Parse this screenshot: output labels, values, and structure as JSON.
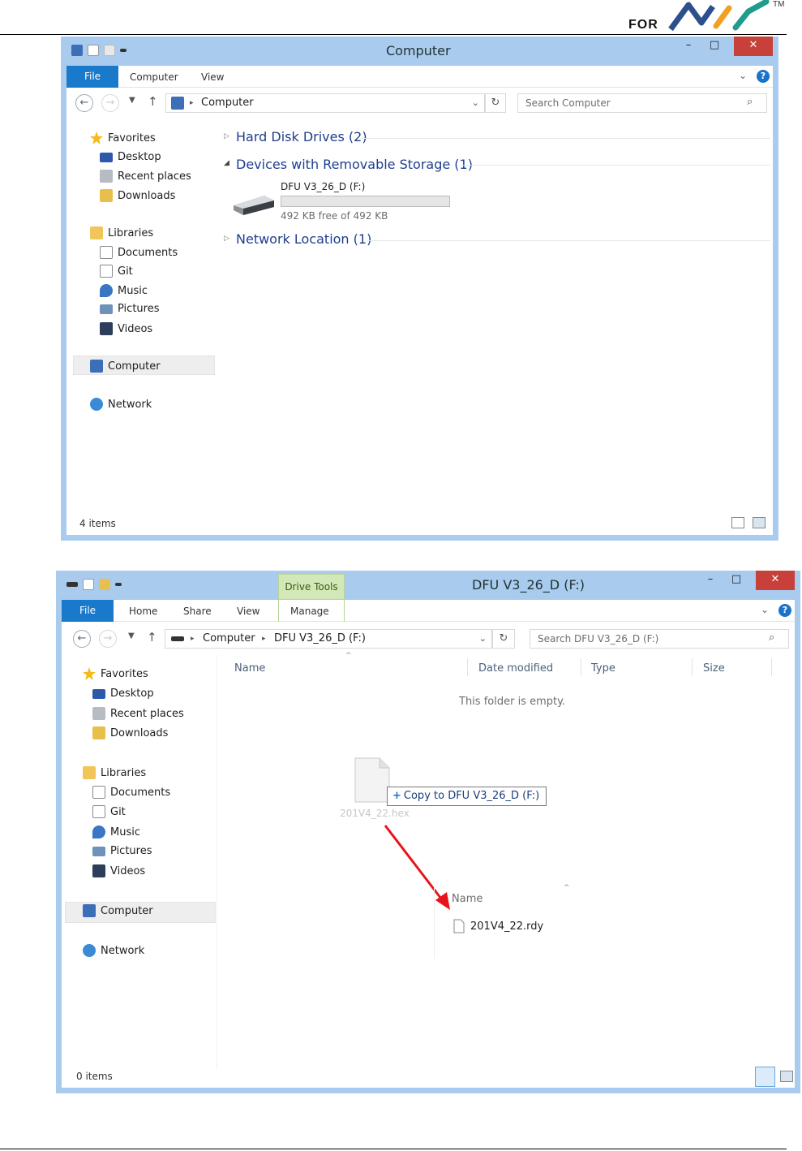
{
  "header": {
    "logo_text": "FOR",
    "trademark": "TM"
  },
  "window1": {
    "title": "Computer",
    "ribbon": {
      "file": "File",
      "tabs": [
        "Computer",
        "View"
      ],
      "help": "?"
    },
    "address": {
      "path": "Computer",
      "search_placeholder": "Search Computer"
    },
    "nav": {
      "favorites": "Favorites",
      "fav_items": [
        "Desktop",
        "Recent places",
        "Downloads"
      ],
      "libraries": "Libraries",
      "lib_items": [
        "Documents",
        "Git",
        "Music",
        "Pictures",
        "Videos"
      ],
      "computer": "Computer",
      "network": "Network"
    },
    "groups": {
      "hdd": "Hard Disk Drives (2)",
      "removable": "Devices with Removable Storage (1)",
      "network": "Network Location (1)"
    },
    "drive": {
      "name": "DFU V3_26_D (F:)",
      "free": "492 KB free of 492 KB",
      "used_fraction": 0
    },
    "status": "4 items"
  },
  "window2": {
    "title": "DFU V3_26_D (F:)",
    "context_tab": "Drive Tools",
    "ribbon": {
      "file": "File",
      "tabs": [
        "Home",
        "Share",
        "View",
        "Manage"
      ],
      "help": "?"
    },
    "address": {
      "root": "Computer",
      "path": "DFU V3_26_D (F:)",
      "search_placeholder": "Search DFU V3_26_D (F:)"
    },
    "nav": {
      "favorites": "Favorites",
      "fav_items": [
        "Desktop",
        "Recent places",
        "Downloads"
      ],
      "libraries": "Libraries",
      "lib_items": [
        "Documents",
        "Git",
        "Music",
        "Pictures",
        "Videos"
      ],
      "computer": "Computer",
      "network": "Network"
    },
    "columns": {
      "name": "Name",
      "date": "Date modified",
      "type": "Type",
      "size": "Size"
    },
    "empty_message": "This folder is empty.",
    "drag": {
      "file": "201V4_22.hex",
      "tooltip_symbol": "+",
      "tooltip": "Copy to DFU V3_26_D (F:)"
    },
    "result": {
      "column": "Name",
      "file": "201V4_22.rdy"
    },
    "status": "0 items"
  },
  "colors": {
    "accent": "#1979ca",
    "frame": "#a8cbee",
    "arrow": "#e8141b",
    "group_text": "#1e3e8e"
  }
}
